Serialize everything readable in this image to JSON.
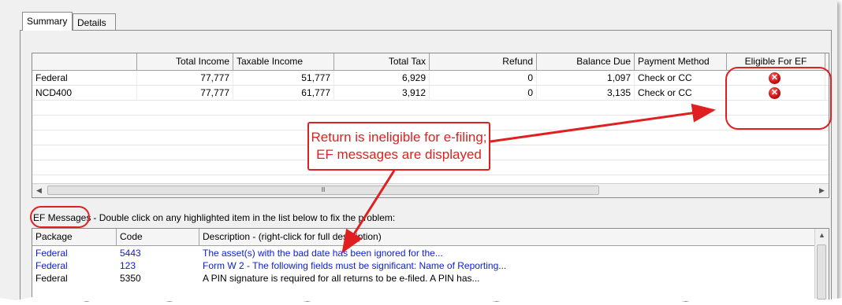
{
  "tabs": [
    {
      "label": "Summary",
      "active": true
    },
    {
      "label": "Details",
      "active": false
    }
  ],
  "summary": {
    "columns": [
      "",
      "Total Income",
      "Taxable Income",
      "Total Tax",
      "Refund",
      "Balance Due",
      "Payment Method",
      "Eligible For EF"
    ],
    "rows": [
      {
        "name": "Federal",
        "total_income": "77,777",
        "taxable_income": "51,777",
        "total_tax": "6,929",
        "refund": "0",
        "balance_due": "1,097",
        "payment_method": "Check or CC",
        "eligible_icon": "error-x-icon"
      },
      {
        "name": "NCD400",
        "total_income": "77,777",
        "taxable_income": "61,777",
        "total_tax": "3,912",
        "refund": "0",
        "balance_due": "3,135",
        "payment_method": "Check or CC",
        "eligible_icon": "error-x-icon"
      }
    ],
    "scroll_thumb_glyph": "Ⅲ"
  },
  "ef": {
    "label": "EF Messages",
    "instruction": "- Double click on any highlighted item in the list below to fix the problem:",
    "columns": [
      "Package",
      "Code",
      "Description - (right-click for full description)"
    ],
    "rows": [
      {
        "package": "Federal",
        "code": "5443",
        "description": "The asset(s) with the bad date has been ignored for the...",
        "highlighted": true
      },
      {
        "package": "Federal",
        "code": "123",
        "description": "Form W 2 - The following fields must be significant: Name of Reporting...",
        "highlighted": true
      },
      {
        "package": "Federal",
        "code": "5350",
        "description": "A PIN signature is required for all returns to be e-filed. A PIN has...",
        "highlighted": false
      }
    ]
  },
  "callout": {
    "line1": "Return is ineligible for e-filing;",
    "line2": "EF messages are displayed"
  },
  "colors": {
    "annotation_red": "#e02020",
    "highlight_blue": "#1020d0"
  }
}
